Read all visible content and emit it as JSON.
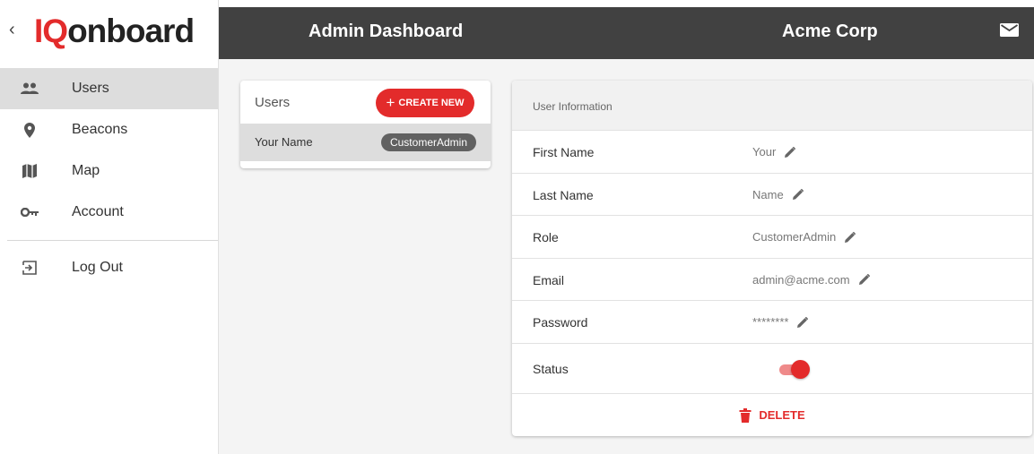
{
  "brand": {
    "back_glyph": "‹",
    "logo_iq": "IQ",
    "logo_rest": "onboard",
    "accent": "#e32b2b"
  },
  "header": {
    "title": "Admin Dashboard",
    "org": "Acme Corp",
    "bg": "#414141"
  },
  "sidebar": {
    "items": [
      {
        "label": "Users",
        "icon": "people-icon",
        "active": true
      },
      {
        "label": "Beacons",
        "icon": "location-pin-icon",
        "active": false
      },
      {
        "label": "Map",
        "icon": "map-icon",
        "active": false
      },
      {
        "label": "Account",
        "icon": "key-icon",
        "active": false
      }
    ],
    "logout": {
      "label": "Log Out",
      "icon": "logout-icon"
    }
  },
  "users_panel": {
    "title": "Users",
    "create_label": "CREATE NEW",
    "rows": [
      {
        "name": "Your Name",
        "role": "CustomerAdmin"
      }
    ]
  },
  "user_info": {
    "title": "User Information",
    "fields": [
      {
        "label": "First Name",
        "value": "Your"
      },
      {
        "label": "Last Name",
        "value": "Name"
      },
      {
        "label": "Role",
        "value": "CustomerAdmin"
      },
      {
        "label": "Email",
        "value": "admin@acme.com"
      },
      {
        "label": "Password",
        "value": "********"
      }
    ],
    "status_label": "Status",
    "status_on": true,
    "delete_label": "DELETE"
  }
}
